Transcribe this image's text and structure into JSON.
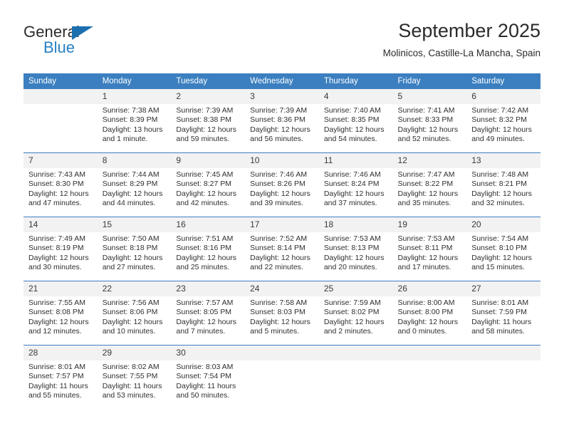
{
  "brand": {
    "line1": "General",
    "line2": "Blue",
    "mark": "triangle-logo",
    "color_primary": "#1b6faf",
    "color_text": "#2581c4"
  },
  "header": {
    "title": "September 2025",
    "subtitle": "Molinicos, Castille-La Mancha, Spain"
  },
  "theme": {
    "header_bg": "#3b7fc0",
    "daynum_bg": "#f2f2f2",
    "grid_line": "#3b7fc0"
  },
  "weekdays": [
    "Sunday",
    "Monday",
    "Tuesday",
    "Wednesday",
    "Thursday",
    "Friday",
    "Saturday"
  ],
  "weeks": [
    [
      {
        "day": "",
        "sunrise": "",
        "sunset": "",
        "daylight": ""
      },
      {
        "day": "1",
        "sunrise": "Sunrise: 7:38 AM",
        "sunset": "Sunset: 8:39 PM",
        "daylight": "Daylight: 13 hours and 1 minute."
      },
      {
        "day": "2",
        "sunrise": "Sunrise: 7:39 AM",
        "sunset": "Sunset: 8:38 PM",
        "daylight": "Daylight: 12 hours and 59 minutes."
      },
      {
        "day": "3",
        "sunrise": "Sunrise: 7:39 AM",
        "sunset": "Sunset: 8:36 PM",
        "daylight": "Daylight: 12 hours and 56 minutes."
      },
      {
        "day": "4",
        "sunrise": "Sunrise: 7:40 AM",
        "sunset": "Sunset: 8:35 PM",
        "daylight": "Daylight: 12 hours and 54 minutes."
      },
      {
        "day": "5",
        "sunrise": "Sunrise: 7:41 AM",
        "sunset": "Sunset: 8:33 PM",
        "daylight": "Daylight: 12 hours and 52 minutes."
      },
      {
        "day": "6",
        "sunrise": "Sunrise: 7:42 AM",
        "sunset": "Sunset: 8:32 PM",
        "daylight": "Daylight: 12 hours and 49 minutes."
      }
    ],
    [
      {
        "day": "7",
        "sunrise": "Sunrise: 7:43 AM",
        "sunset": "Sunset: 8:30 PM",
        "daylight": "Daylight: 12 hours and 47 minutes."
      },
      {
        "day": "8",
        "sunrise": "Sunrise: 7:44 AM",
        "sunset": "Sunset: 8:29 PM",
        "daylight": "Daylight: 12 hours and 44 minutes."
      },
      {
        "day": "9",
        "sunrise": "Sunrise: 7:45 AM",
        "sunset": "Sunset: 8:27 PM",
        "daylight": "Daylight: 12 hours and 42 minutes."
      },
      {
        "day": "10",
        "sunrise": "Sunrise: 7:46 AM",
        "sunset": "Sunset: 8:26 PM",
        "daylight": "Daylight: 12 hours and 39 minutes."
      },
      {
        "day": "11",
        "sunrise": "Sunrise: 7:46 AM",
        "sunset": "Sunset: 8:24 PM",
        "daylight": "Daylight: 12 hours and 37 minutes."
      },
      {
        "day": "12",
        "sunrise": "Sunrise: 7:47 AM",
        "sunset": "Sunset: 8:22 PM",
        "daylight": "Daylight: 12 hours and 35 minutes."
      },
      {
        "day": "13",
        "sunrise": "Sunrise: 7:48 AM",
        "sunset": "Sunset: 8:21 PM",
        "daylight": "Daylight: 12 hours and 32 minutes."
      }
    ],
    [
      {
        "day": "14",
        "sunrise": "Sunrise: 7:49 AM",
        "sunset": "Sunset: 8:19 PM",
        "daylight": "Daylight: 12 hours and 30 minutes."
      },
      {
        "day": "15",
        "sunrise": "Sunrise: 7:50 AM",
        "sunset": "Sunset: 8:18 PM",
        "daylight": "Daylight: 12 hours and 27 minutes."
      },
      {
        "day": "16",
        "sunrise": "Sunrise: 7:51 AM",
        "sunset": "Sunset: 8:16 PM",
        "daylight": "Daylight: 12 hours and 25 minutes."
      },
      {
        "day": "17",
        "sunrise": "Sunrise: 7:52 AM",
        "sunset": "Sunset: 8:14 PM",
        "daylight": "Daylight: 12 hours and 22 minutes."
      },
      {
        "day": "18",
        "sunrise": "Sunrise: 7:53 AM",
        "sunset": "Sunset: 8:13 PM",
        "daylight": "Daylight: 12 hours and 20 minutes."
      },
      {
        "day": "19",
        "sunrise": "Sunrise: 7:53 AM",
        "sunset": "Sunset: 8:11 PM",
        "daylight": "Daylight: 12 hours and 17 minutes."
      },
      {
        "day": "20",
        "sunrise": "Sunrise: 7:54 AM",
        "sunset": "Sunset: 8:10 PM",
        "daylight": "Daylight: 12 hours and 15 minutes."
      }
    ],
    [
      {
        "day": "21",
        "sunrise": "Sunrise: 7:55 AM",
        "sunset": "Sunset: 8:08 PM",
        "daylight": "Daylight: 12 hours and 12 minutes."
      },
      {
        "day": "22",
        "sunrise": "Sunrise: 7:56 AM",
        "sunset": "Sunset: 8:06 PM",
        "daylight": "Daylight: 12 hours and 10 minutes."
      },
      {
        "day": "23",
        "sunrise": "Sunrise: 7:57 AM",
        "sunset": "Sunset: 8:05 PM",
        "daylight": "Daylight: 12 hours and 7 minutes."
      },
      {
        "day": "24",
        "sunrise": "Sunrise: 7:58 AM",
        "sunset": "Sunset: 8:03 PM",
        "daylight": "Daylight: 12 hours and 5 minutes."
      },
      {
        "day": "25",
        "sunrise": "Sunrise: 7:59 AM",
        "sunset": "Sunset: 8:02 PM",
        "daylight": "Daylight: 12 hours and 2 minutes."
      },
      {
        "day": "26",
        "sunrise": "Sunrise: 8:00 AM",
        "sunset": "Sunset: 8:00 PM",
        "daylight": "Daylight: 12 hours and 0 minutes."
      },
      {
        "day": "27",
        "sunrise": "Sunrise: 8:01 AM",
        "sunset": "Sunset: 7:59 PM",
        "daylight": "Daylight: 11 hours and 58 minutes."
      }
    ],
    [
      {
        "day": "28",
        "sunrise": "Sunrise: 8:01 AM",
        "sunset": "Sunset: 7:57 PM",
        "daylight": "Daylight: 11 hours and 55 minutes."
      },
      {
        "day": "29",
        "sunrise": "Sunrise: 8:02 AM",
        "sunset": "Sunset: 7:55 PM",
        "daylight": "Daylight: 11 hours and 53 minutes."
      },
      {
        "day": "30",
        "sunrise": "Sunrise: 8:03 AM",
        "sunset": "Sunset: 7:54 PM",
        "daylight": "Daylight: 11 hours and 50 minutes."
      },
      {
        "day": "",
        "sunrise": "",
        "sunset": "",
        "daylight": ""
      },
      {
        "day": "",
        "sunrise": "",
        "sunset": "",
        "daylight": ""
      },
      {
        "day": "",
        "sunrise": "",
        "sunset": "",
        "daylight": ""
      },
      {
        "day": "",
        "sunrise": "",
        "sunset": "",
        "daylight": ""
      }
    ]
  ]
}
